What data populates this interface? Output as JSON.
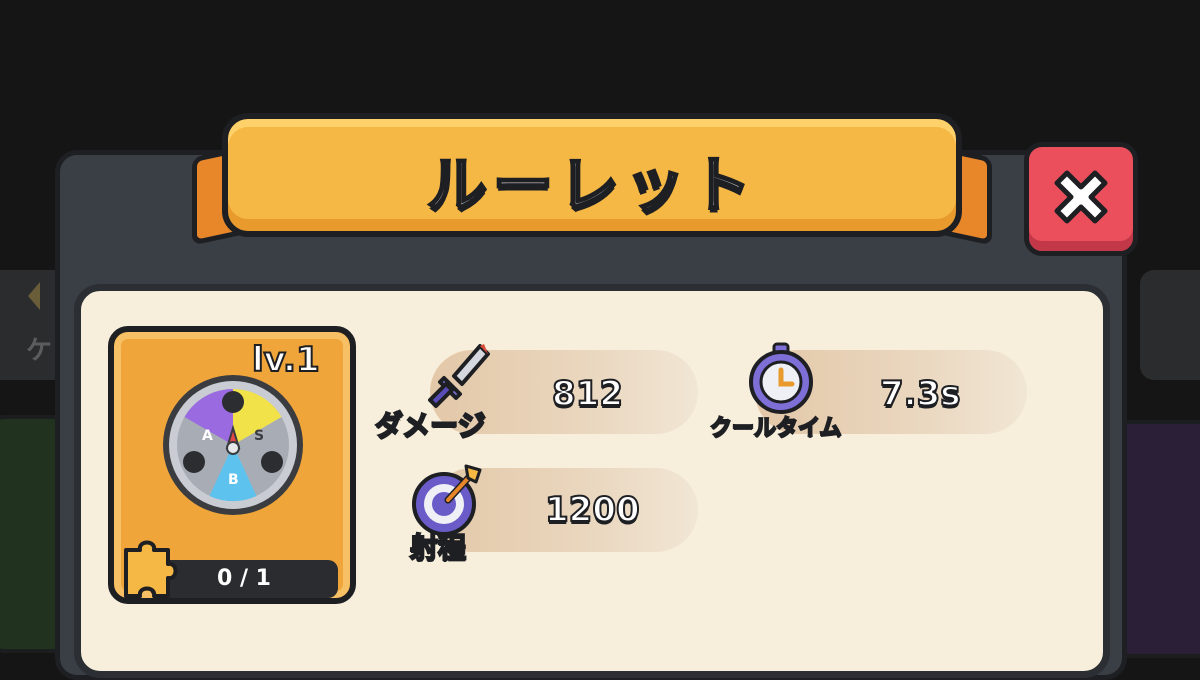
{
  "dialog": {
    "title": "ルーレット",
    "close_icon": "close-icon"
  },
  "background": {
    "left_glyph": "ケ"
  },
  "skill_card": {
    "level": "lv.1",
    "wheel_segments": [
      "A",
      "S",
      "B"
    ],
    "fragments": "0 / 1",
    "icon": "roulette-wheel-icon"
  },
  "stats": {
    "damage": {
      "label": "ダメージ",
      "value": "812",
      "icon": "dagger-icon"
    },
    "cooldown": {
      "label": "クールタイム",
      "value": "7.3s",
      "icon": "stopwatch-icon"
    },
    "range": {
      "label": "射程",
      "value": "1200",
      "icon": "target-icon"
    }
  },
  "colors": {
    "banner": "#f6b845",
    "close": "#ea4f5b",
    "card": "#f0a53a",
    "body": "#f7efdc",
    "wheel_purple": "#9a6ae0",
    "wheel_yellow": "#f2e24a",
    "wheel_blue": "#5ec2ee"
  }
}
